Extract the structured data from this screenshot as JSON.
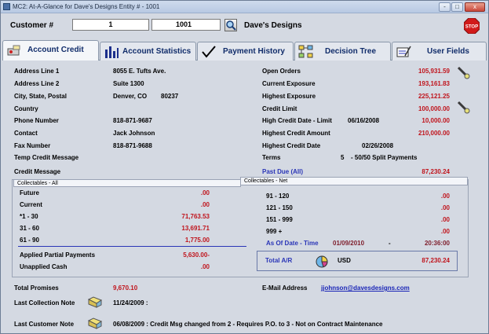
{
  "window": {
    "title": "MC2: At-A-Glance for Dave's Designs     Entity # - 1001",
    "btn_minimize": "-",
    "btn_restore": "□",
    "btn_close": "x"
  },
  "toolbar": {
    "customer_label": "Customer #",
    "customer_value": "1",
    "entity_value": "1001",
    "customer_name": "Dave's Designs"
  },
  "tabs": [
    {
      "label": "Account Credit",
      "icon": "account-credit-icon"
    },
    {
      "label": "Account Statistics",
      "icon": "bar-chart-icon"
    },
    {
      "label": "Payment History",
      "icon": "checkmark-icon"
    },
    {
      "label": "Decision Tree",
      "icon": "decision-tree-icon"
    },
    {
      "label": "User Fields",
      "icon": "user-fields-icon"
    }
  ],
  "address": {
    "line1_label": "Address Line 1",
    "line1_value": "8055 E. Tufts Ave.",
    "line2_label": "Address Line 2",
    "line2_value": "Suite 1300",
    "city_label": "City, State, Postal",
    "city_value": "Denver, CO",
    "postal_value": "80237",
    "country_label": "Country",
    "phone_label": "Phone Number",
    "phone_value": "818-871-9687",
    "contact_label": "Contact",
    "contact_value": "Jack Johnson",
    "fax_label": "Fax Number",
    "fax_value": "818-871-9688",
    "temp_msg_label": "Temp Credit Message",
    "credit_msg_label": "Credit Message"
  },
  "credit": {
    "open_orders_label": "Open Orders",
    "open_orders_value": "105,931.59",
    "current_exposure_label": "Current Exposure",
    "current_exposure_value": "193,161.83",
    "highest_exposure_label": "Highest Exposure",
    "highest_exposure_value": "225,121.25",
    "credit_limit_label": "Credit Limit",
    "credit_limit_value": "100,000.00",
    "high_credit_date_label": "High Credit Date - Limit",
    "high_credit_date_value": "06/16/2008",
    "high_credit_limit_value": "10,000.00",
    "highest_credit_amount_label": "Highest Credit Amount",
    "highest_credit_amount_value": "210,000.00",
    "highest_credit_date_label": "Highest Credit Date",
    "highest_credit_date_value": "02/26/2008",
    "terms_label": "Terms",
    "terms_code": "5",
    "terms_value": "- 50/50 Split Payments",
    "past_due_label": "Past Due (All)",
    "past_due_value": "87,230.24"
  },
  "collectables_all": {
    "header": "Collectables - All",
    "rows": [
      {
        "label": "Future",
        "value": ".00"
      },
      {
        "label": "Current",
        "value": ".00"
      },
      {
        "label": "*1 - 30",
        "value": "71,763.53"
      },
      {
        "label": "31 - 60",
        "value": "13,691.71"
      },
      {
        "label": "61 - 90",
        "value": "1,775.00"
      }
    ],
    "applied_label": "Applied Partial Payments",
    "applied_value": "5,630.00-",
    "unapplied_label": "Unapplied Cash",
    "unapplied_value": ".00"
  },
  "collectables_net": {
    "header": "Collectables - Net",
    "rows": [
      {
        "label": "91 - 120",
        "value": ".00"
      },
      {
        "label": "121 - 150",
        "value": ".00"
      },
      {
        "label": "151 - 999",
        "value": ".00"
      },
      {
        "label": "999 +",
        "value": ".00"
      }
    ],
    "as_of_label": "As Of Date - Time",
    "as_of_date": "01/09/2010",
    "as_of_dash": "-",
    "as_of_time": "20:36:00",
    "total_ar_label": "Total A/R",
    "currency": "USD",
    "total_ar_value": "87,230.24"
  },
  "footer": {
    "total_promises_label": "Total Promises",
    "total_promises_value": "9,670.10",
    "email_label": "E-Mail Address",
    "email_value": "jjohnson@davesdesigns.com",
    "last_collection_label": "Last Collection Note",
    "last_collection_value": "11/24/2009 :",
    "last_customer_label": "Last Customer Note",
    "last_customer_value": "06/08/2009 : Credit Msg changed from 2  - Requires P.O. to 3  - Not on Contract Maintenance"
  },
  "colors": {
    "accent": "#102c6a",
    "value_red": "#c0141c",
    "link_blue": "#1b26b7"
  }
}
